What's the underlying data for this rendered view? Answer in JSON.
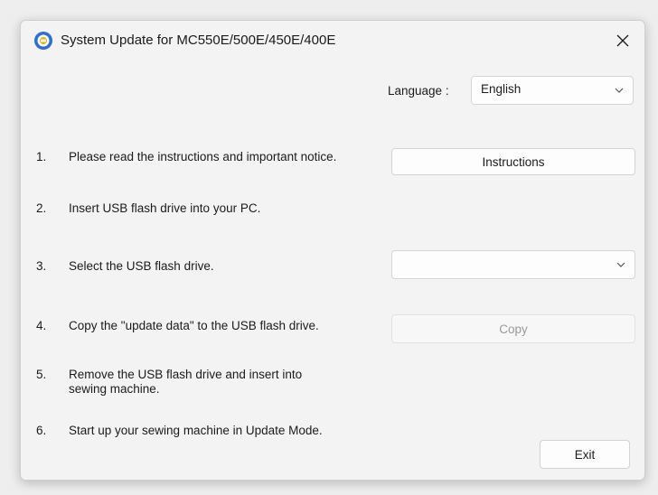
{
  "window": {
    "title": "System Update for MC550E/500E/450E/400E"
  },
  "language": {
    "label": "Language :",
    "selected": "English"
  },
  "usb_drive": {
    "selected": ""
  },
  "steps": [
    {
      "num": "1.",
      "text": "Please read the instructions and important notice."
    },
    {
      "num": "2.",
      "text": "Insert USB flash drive into your PC."
    },
    {
      "num": "3.",
      "text": "Select the USB flash drive."
    },
    {
      "num": "4.",
      "text": "Copy the \"update data\" to the USB flash drive."
    },
    {
      "num": "5.",
      "text": "Remove the USB flash drive and insert into sewing machine."
    },
    {
      "num": "6.",
      "text": "Start up your sewing machine in Update Mode."
    }
  ],
  "buttons": {
    "instructions": "Instructions",
    "copy": "Copy",
    "exit": "Exit"
  },
  "colors": {
    "icon_blue": "#2b6fd6",
    "disabled_text": "#9a9a9a"
  }
}
